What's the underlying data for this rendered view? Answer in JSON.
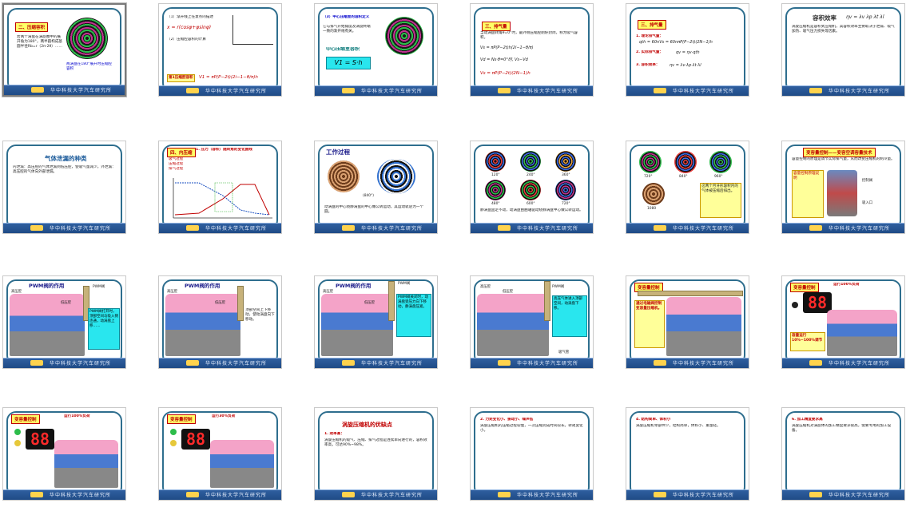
{
  "app": {
    "view": "slide-sorter"
  },
  "footer_text": "华中科技大学汽车研究所",
  "slides": [
    {
      "n": 1,
      "tag": "二、压缩容积",
      "body": "若两个涡盘在涡旋圈中的展开角为180°，两半圆构成基圆半径Rb=r（2π-2θ）……"
    },
    {
      "n": 2,
      "line1": "（1）渐开线上任意点的描述",
      "line2": "（2）压缩腔容积的计算",
      "box": "第1压缩腔容积",
      "formula": "V1 = πP(P−2t)(2i−1−θ/π)h"
    },
    {
      "n": 3,
      "line1": "（3）中心压缩室的容积定义",
      "line2": "它与排气开始角度及涡旋终端一致的渐开线有关。",
      "box": "中心压缩室容积",
      "formula": "V1 = S·h"
    },
    {
      "n": 4,
      "tag": "三、排气量",
      "line1": "当动涡盘转角θ=0°时，最外侧压缩腔刚好封闭，称为吸气容积。",
      "f1": "Vs = πP(P−2t)h(2i−1−θ/π)",
      "f2": "Vd = Ns·θ=0°时, Vs−Vd",
      "f3": "Vs = πP(P−2t)(2N−1)h"
    },
    {
      "n": 5,
      "tag": "三、排气量",
      "l1": "1. 理论排气量：",
      "f1": "qth = 60nVs = 60nπP(P−2t)(2N−1)h",
      "l2": "2. 实际排气量：",
      "f2": "qv = ηv·qth",
      "l3": "3. 容积效率：",
      "f3": "ηv = λv·λp·λt·λl"
    },
    {
      "n": 6,
      "title": "容积效率",
      "formula": "ηv = λv λp λt λl",
      "txt": "涡旋压缩机是容积式压缩机，其容积效率主要取决于泄漏、吸气加热、吸气压力损失等因素。"
    },
    {
      "n": 7,
      "title": "气体泄漏的种类",
      "txt": "内泄漏：高压腔的气体泄漏到低压腔，使吸气量减少。外泄漏：高压腔的气体向外部泄漏。"
    },
    {
      "n": 8,
      "tag": "四、内压缩",
      "title": "1. 压力（容积）随转角的变化曲线",
      "legend": [
        "吸气过程",
        "压缩过程",
        "排气过程"
      ]
    },
    {
      "n": 9,
      "title": "工作过程",
      "caption": "动涡盘的中心绕静涡盘的中心做公转运动，其运动轨迹为一个圆。",
      "deg": "(840°)"
    },
    {
      "n": 10,
      "angles": [
        "120°",
        "240°",
        "360°",
        "480°",
        "600°",
        "720°"
      ],
      "caption": "静涡盘固定不动，动涡盘由曲轴驱动绕静涡盘中心做公转运动。"
    },
    {
      "n": 11,
      "angles": [
        "720°",
        "840°",
        "960°",
        "1080"
      ],
      "note": "这两个月牙形容积内的气体被压缩后排出。"
    },
    {
      "n": 12,
      "tag": "变容量控制——变容空调容量技术",
      "txt": "容量控制的原理是调节实际排气量，从而改变压缩机的制冷量。"
    },
    {
      "n": 13,
      "title": "PWM阀的作用",
      "labels": [
        "高压腔",
        "低压腔",
        "PWM阀"
      ],
      "note": "PWM阀打开时，顶部空间与吸入侧连通，动涡盘上移……"
    },
    {
      "n": 14,
      "title": "PWM阀的作用",
      "labels": [
        "高压腔",
        "低压腔"
      ],
      "note": "顶部空间上下移动，使动涡盘向下移动。"
    },
    {
      "n": 15,
      "title": "PWM阀的作用",
      "labels": [
        "高压腔",
        "低压腔",
        "PWM阀"
      ],
      "note": "PWM阀关闭时，动涡盘受压力向下移动，静涡盘压紧。"
    },
    {
      "n": 16,
      "labels": [
        "高压腔",
        "低压腔",
        "PWM阀",
        "吸气管"
      ],
      "note": "高压气体进入顶部空间，动涡盘下移。"
    },
    {
      "n": 17,
      "tag": "变容量控制",
      "note": "通过电磁阀控制变容量压缩机。"
    },
    {
      "n": 18,
      "tag": "变容量控制",
      "digits": "88",
      "label": "运行100%负荷",
      "note": "容量运行10%~100%调节"
    },
    {
      "n": 19,
      "tag": "变容量控制",
      "digits": "88",
      "label": "运行100%负荷"
    },
    {
      "n": 20,
      "tag": "变容量控制",
      "digits": "88",
      "label": "运行30%负荷"
    },
    {
      "n": 21,
      "title": "涡旋压缩机的优缺点",
      "l1": "1. 效率高：",
      "txt": "涡旋压缩机的吸气、压缩、排气过程是连续单向进行的，容积效率高，可达90%~98%。"
    },
    {
      "n": 22,
      "l1": "2. 力矩变化小、振动小、噪声低",
      "txt": "涡旋压缩机的压缩过程较慢，一次压缩完成时间较长，转矩变化小。"
    },
    {
      "n": 23,
      "l1": "4. 结构简单、体积小",
      "txt": "涡旋压缩机零部件少，结构简单，体积小、重量轻。"
    },
    {
      "n": 24,
      "l1": "6. 加工精度要求高",
      "txt": "涡旋压缩机对涡旋体的加工精度要求很高，需要专用的加工设备。"
    }
  ],
  "colors": {
    "frame": "#2e6e8e",
    "footer": "#1f4b86",
    "accent": "#c00000",
    "highlight": "#ffff66",
    "cyan": "#29e6ee"
  }
}
